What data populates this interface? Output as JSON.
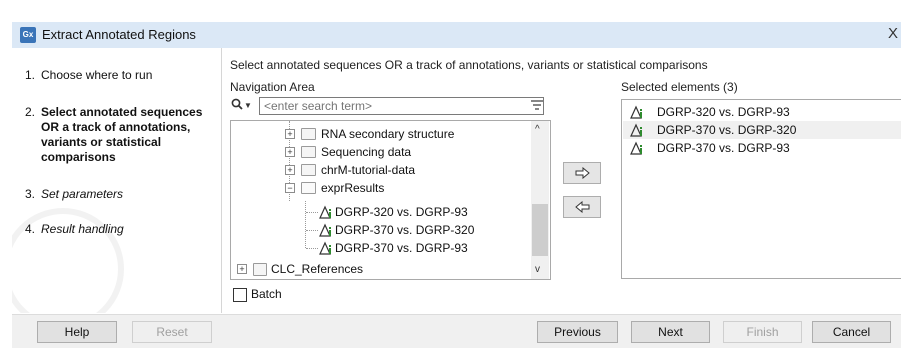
{
  "window": {
    "app_icon": "Gx",
    "title": "Extract Annotated Regions",
    "close_glyph": "X"
  },
  "steps": [
    {
      "number": "1.",
      "label": "Choose where to run",
      "state": "done"
    },
    {
      "number": "2.",
      "label": "Select annotated sequences OR a track of annotations, variants or statistical comparisons",
      "state": "current"
    },
    {
      "number": "3.",
      "label": "Set parameters",
      "state": "future"
    },
    {
      "number": "4.",
      "label": "Result handling",
      "state": "future"
    }
  ],
  "instruction": "Select annotated sequences OR a track of annotations, variants or statistical comparisons",
  "navigation": {
    "label": "Navigation Area",
    "search_placeholder": "<enter search term>",
    "tree": [
      {
        "label": "RNA secondary structure",
        "kind": "folder",
        "expanded": false
      },
      {
        "label": "Sequencing data",
        "kind": "folder",
        "expanded": false
      },
      {
        "label": "chrM-tutorial-data",
        "kind": "folder",
        "expanded": false
      },
      {
        "label": "exprResults",
        "kind": "folder",
        "expanded": true
      },
      {
        "label": "DGRP-320 vs. DGRP-93",
        "kind": "track"
      },
      {
        "label": "DGRP-370 vs. DGRP-320",
        "kind": "track"
      },
      {
        "label": "DGRP-370 vs. DGRP-93",
        "kind": "track"
      },
      {
        "label": "CLC_References",
        "kind": "ref-folder",
        "expanded": false
      }
    ]
  },
  "selected": {
    "label": "Selected elements (3)",
    "items": [
      "DGRP-320 vs. DGRP-93",
      "DGRP-370 vs. DGRP-320",
      "DGRP-370 vs. DGRP-93"
    ]
  },
  "batch": {
    "label": "Batch",
    "checked": false
  },
  "buttons": {
    "help": "Help",
    "reset": "Reset",
    "previous": "Previous",
    "next": "Next",
    "finish": "Finish",
    "cancel": "Cancel"
  },
  "colors": {
    "title_bar": "#dbe8f6",
    "app_icon": "#3a74b8",
    "track_icon_green": "#2e8b2e"
  }
}
